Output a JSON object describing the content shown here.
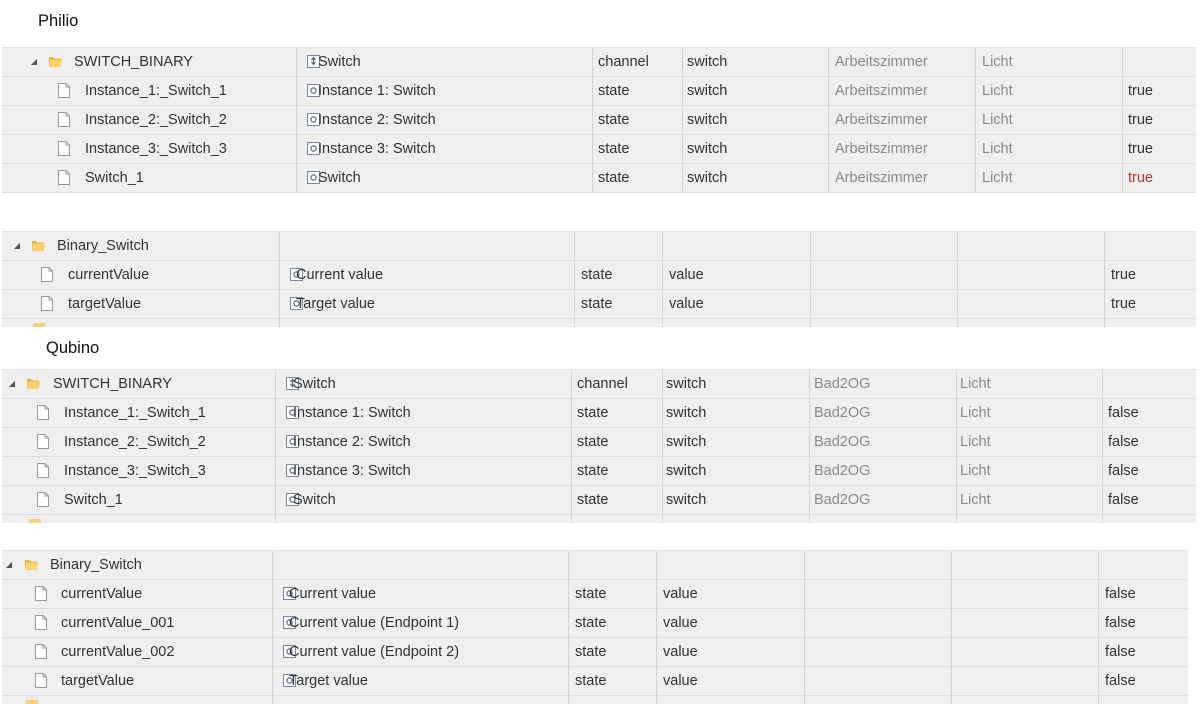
{
  "headings": {
    "philio": "Philio",
    "qubino": "Qubino"
  },
  "philio_switch": [
    {
      "kind": "folder",
      "id": "SWITCH_BINARY",
      "icon": "channel-icon",
      "name": "Switch",
      "type": "channel",
      "role": "switch",
      "room": "Arbeitszimmer",
      "function": "Licht",
      "value": ""
    },
    {
      "kind": "file",
      "id": "Instance_1:_Switch_1",
      "icon": "state-icon",
      "name": "Instance 1: Switch",
      "type": "state",
      "role": "switch",
      "room": "Arbeitszimmer",
      "function": "Licht",
      "value": "true"
    },
    {
      "kind": "file",
      "id": "Instance_2:_Switch_2",
      "icon": "state-icon",
      "name": "Instance 2: Switch",
      "type": "state",
      "role": "switch",
      "room": "Arbeitszimmer",
      "function": "Licht",
      "value": "true"
    },
    {
      "kind": "file",
      "id": "Instance_3:_Switch_3",
      "icon": "state-icon",
      "name": "Instance 3: Switch",
      "type": "state",
      "role": "switch",
      "room": "Arbeitszimmer",
      "function": "Licht",
      "value": "true"
    },
    {
      "kind": "file",
      "id": "Switch_1",
      "icon": "state-icon",
      "name": "Switch",
      "type": "state",
      "role": "switch",
      "room": "Arbeitszimmer",
      "function": "Licht",
      "value": "true",
      "value_color": "red"
    }
  ],
  "philio_binary": [
    {
      "kind": "folder",
      "id": "Binary_Switch",
      "icon": "",
      "name": "",
      "type": "",
      "role": "",
      "room": "",
      "function": "",
      "value": ""
    },
    {
      "kind": "file",
      "id": "currentValue",
      "icon": "state-icon",
      "name": "Current value",
      "type": "state",
      "role": "value",
      "room": "",
      "function": "",
      "value": "true"
    },
    {
      "kind": "file",
      "id": "targetValue",
      "icon": "state-icon",
      "name": "Target value",
      "type": "state",
      "role": "value",
      "room": "",
      "function": "",
      "value": "true"
    }
  ],
  "qubino_switch": [
    {
      "kind": "folder",
      "id": "SWITCH_BINARY",
      "icon": "channel-icon",
      "name": "Switch",
      "type": "channel",
      "role": "switch",
      "room": "Bad2OG",
      "function": "Licht",
      "value": ""
    },
    {
      "kind": "file",
      "id": "Instance_1:_Switch_1",
      "icon": "state-icon",
      "name": "Instance 1: Switch",
      "type": "state",
      "role": "switch",
      "room": "Bad2OG",
      "function": "Licht",
      "value": "false"
    },
    {
      "kind": "file",
      "id": "Instance_2:_Switch_2",
      "icon": "state-icon",
      "name": "Instance 2: Switch",
      "type": "state",
      "role": "switch",
      "room": "Bad2OG",
      "function": "Licht",
      "value": "false"
    },
    {
      "kind": "file",
      "id": "Instance_3:_Switch_3",
      "icon": "state-icon",
      "name": "Instance 3: Switch",
      "type": "state",
      "role": "switch",
      "room": "Bad2OG",
      "function": "Licht",
      "value": "false"
    },
    {
      "kind": "file",
      "id": "Switch_1",
      "icon": "state-icon",
      "name": "Switch",
      "type": "state",
      "role": "switch",
      "room": "Bad2OG",
      "function": "Licht",
      "value": "false"
    }
  ],
  "qubino_binary": [
    {
      "kind": "folder",
      "id": "Binary_Switch",
      "icon": "",
      "name": "",
      "type": "",
      "role": "",
      "room": "",
      "function": "",
      "value": ""
    },
    {
      "kind": "file",
      "id": "currentValue",
      "icon": "state-icon",
      "name": "Current value",
      "type": "state",
      "role": "value",
      "room": "",
      "function": "",
      "value": "false"
    },
    {
      "kind": "file",
      "id": "currentValue_001",
      "icon": "state-icon",
      "name": "Current value (Endpoint 1)",
      "type": "state",
      "role": "value",
      "room": "",
      "function": "",
      "value": "false"
    },
    {
      "kind": "file",
      "id": "currentValue_002",
      "icon": "state-icon",
      "name": "Current value (Endpoint 2)",
      "type": "state",
      "role": "value",
      "room": "",
      "function": "",
      "value": "false"
    },
    {
      "kind": "file",
      "id": "targetValue",
      "icon": "state-icon",
      "name": "Target value",
      "type": "state",
      "role": "value",
      "room": "",
      "function": "",
      "value": "false"
    }
  ],
  "colors": {
    "text": "#333333",
    "muted": "#8a8a8a",
    "red": "#c03030",
    "row_bg": "#efefef",
    "folder": "#f1c14a"
  }
}
